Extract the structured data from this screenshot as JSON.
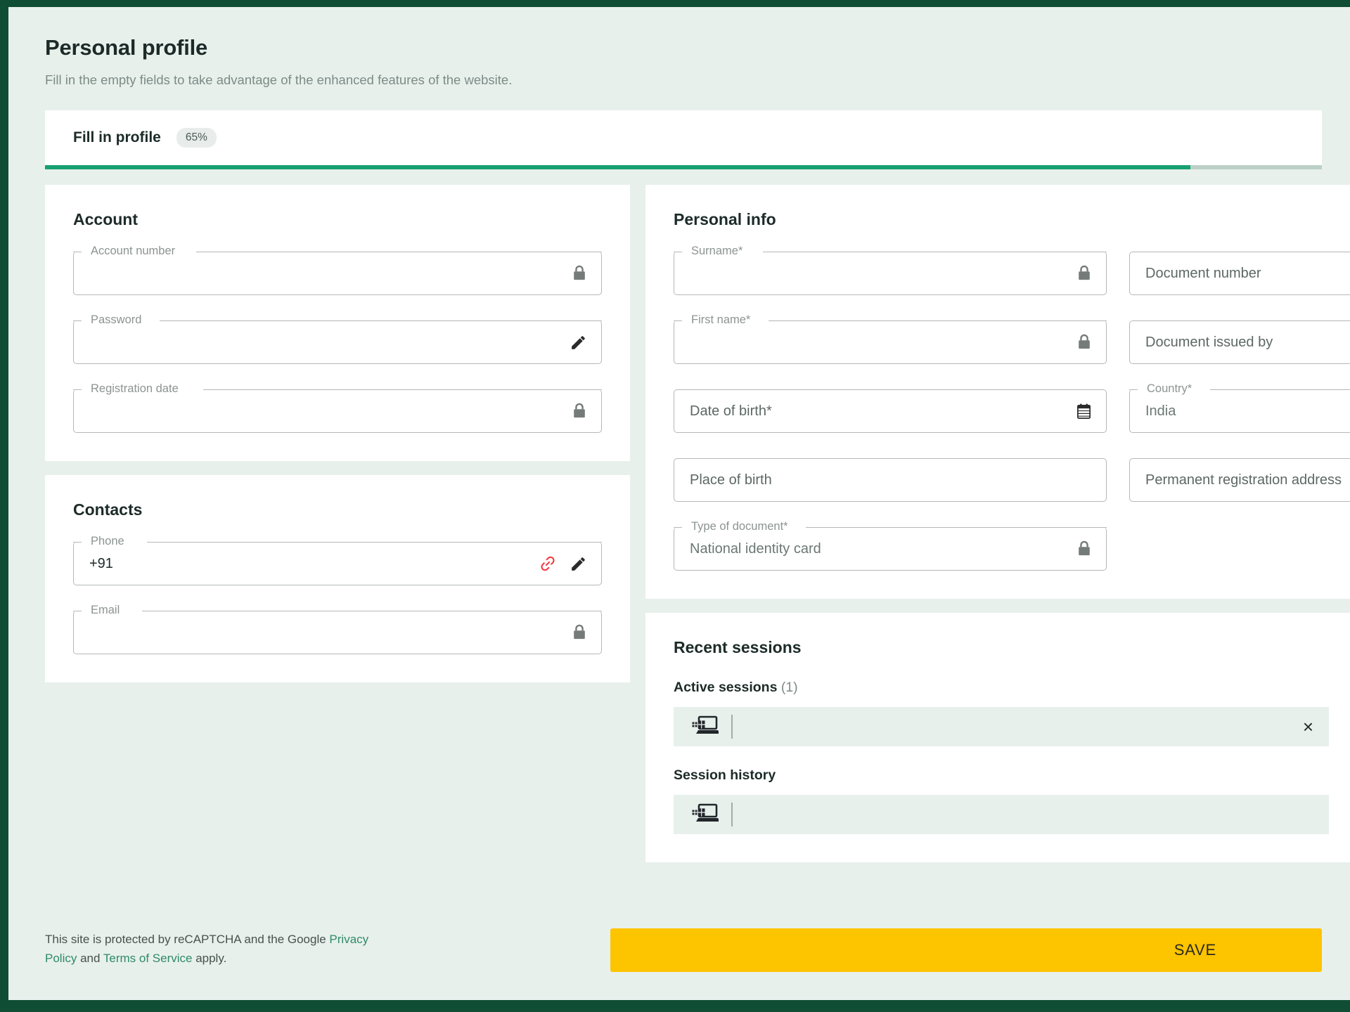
{
  "theme": {
    "frame_green": "#0f4d34",
    "page_bg": "#e8f0ec",
    "progress_green": "#17a072",
    "save_yellow": "#fdc400",
    "link_green": "#2e8b66",
    "link_icon_red": "#f2373f"
  },
  "header": {
    "title": "Personal profile",
    "subtitle": "Fill in the empty fields to take advantage of the enhanced features of the website."
  },
  "progress": {
    "tab_label": "Fill in profile",
    "percent_label": "65%",
    "percent_value": 65
  },
  "account": {
    "title": "Account",
    "fields": [
      {
        "label": "Account number",
        "value": "",
        "icon": "lock-icon"
      },
      {
        "label": "Password",
        "value": "",
        "icon": "pencil-icon"
      },
      {
        "label": "Registration date",
        "value": "",
        "icon": "lock-icon"
      }
    ]
  },
  "contacts": {
    "title": "Contacts",
    "fields": [
      {
        "label": "Phone",
        "value": "+91",
        "icons": [
          "link-icon",
          "pencil-icon"
        ]
      },
      {
        "label": "Email",
        "value": "",
        "icons": [
          "lock-icon"
        ]
      }
    ]
  },
  "personal_info": {
    "title": "Personal info",
    "left_fields": [
      {
        "label": "Surname*",
        "value": "",
        "style": "notched",
        "icon": "lock-icon"
      },
      {
        "label": "First name*",
        "value": "",
        "style": "notched",
        "icon": "lock-icon"
      },
      {
        "placeholder": "Date of birth*",
        "style": "placeholder",
        "icon": "calendar-icon"
      },
      {
        "placeholder": "Place of birth",
        "style": "placeholder",
        "icon": "none"
      },
      {
        "label": "Type of document*",
        "value": "National identity card",
        "style": "notched",
        "icon": "lock-icon"
      }
    ],
    "right_fields": [
      {
        "placeholder": "Document number",
        "style": "placeholder",
        "icon": "none"
      },
      {
        "placeholder": "Document issued by",
        "style": "placeholder",
        "icon": "none"
      },
      {
        "label": "Country*",
        "value": "India",
        "style": "notched",
        "icon": "none"
      },
      {
        "placeholder": "Permanent registration address",
        "style": "placeholder",
        "icon": "none"
      }
    ]
  },
  "sessions": {
    "title": "Recent sessions",
    "active_label": "Active sessions",
    "active_count": "(1)",
    "history_label": "Session history",
    "active_row": {
      "icon": "windows-device-icon",
      "close": "×"
    },
    "history_row": {
      "icon": "windows-device-icon"
    }
  },
  "footer": {
    "recaptcha_prefix": "This site is protected by reCAPTCHA and the Google ",
    "privacy_link": "Privacy Policy",
    "recaptcha_middle": " and ",
    "terms_link": "Terms of Service",
    "recaptcha_suffix": " apply.",
    "save_label": "SAVE"
  }
}
